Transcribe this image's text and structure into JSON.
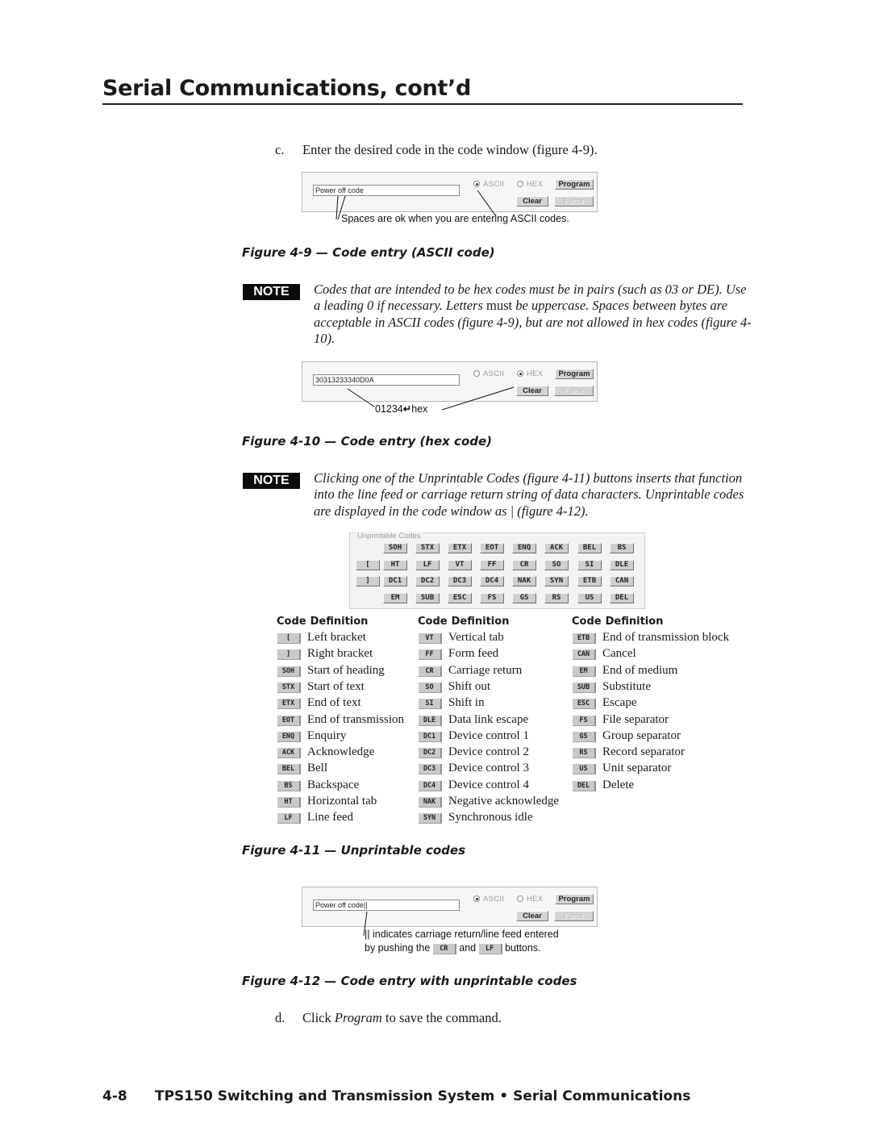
{
  "header": {
    "title": "Serial Communications, cont’d"
  },
  "steps": {
    "c": {
      "marker": "c.",
      "text": "Enter the desired code in the code window (figure 4-9)."
    },
    "d": {
      "marker": "d.",
      "text_before": "Click ",
      "text_em": "Program",
      "text_after": " to save the command."
    }
  },
  "code_window": {
    "radio_ascii": "ASCII",
    "radio_hex": "HEX",
    "program_label": "Program",
    "clear_label": "Clear",
    "force_label": "Force"
  },
  "figure_4_9": {
    "field_value": "Power off code",
    "selected_mode": "ASCII",
    "callout": "Spaces are ok when you are entering ASCII codes.",
    "caption": "Figure 4-9 — Code entry (ASCII code)"
  },
  "note_1": {
    "badge": "NOTE",
    "text_a": "Codes that are intended to be hex codes must be in pairs (such as 03 or DE). Use a leading 0 if necessary.  Letters ",
    "text_upright": "must",
    "text_b": " be uppercase.  Spaces between bytes are acceptable in ASCII codes (figure 4-9), but are not allowed in hex codes (figure 4-10)."
  },
  "figure_4_10": {
    "field_value": "30313233340D0A",
    "selected_mode": "HEX",
    "callout_a": "01234",
    "callout_icon": "return-arrow-icon",
    "callout_b": "hex",
    "caption": "Figure 4-10 — Code entry (hex code)"
  },
  "note_2": {
    "badge": "NOTE",
    "text": "Clicking one of the Unprintable Codes (figure 4-11) buttons inserts that function into the line feed or carriage return string of data characters. Unprintable codes are displayed in the code window as | (figure 4-12)."
  },
  "figure_4_11": {
    "panel_title": "Unprintable Codes",
    "grid": [
      [
        "",
        "SOH",
        "STX",
        "ETX",
        "EOT",
        "ENQ",
        "ACK",
        "BEL",
        "BS"
      ],
      [
        "[",
        "HT",
        "LF",
        "VT",
        "FF",
        "CR",
        "SO",
        "SI",
        "DLE"
      ],
      [
        "]",
        "DC1",
        "DC2",
        "DC3",
        "DC4",
        "NAK",
        "SYN",
        "ETB",
        "CAN"
      ],
      [
        "",
        "EM",
        "SUB",
        "ESC",
        "FS",
        "GS",
        "RS",
        "US",
        "DEL"
      ]
    ],
    "legend_headers": {
      "code": "Code",
      "definition": "Definition"
    },
    "legend_columns": [
      [
        {
          "code": "[",
          "definition": "Left bracket"
        },
        {
          "code": "]",
          "definition": "Right bracket"
        },
        {
          "code": "SOH",
          "definition": "Start of heading"
        },
        {
          "code": "STX",
          "definition": "Start of text"
        },
        {
          "code": "ETX",
          "definition": "End of text"
        },
        {
          "code": "EOT",
          "definition": "End of transmission"
        },
        {
          "code": "ENQ",
          "definition": "Enquiry"
        },
        {
          "code": "ACK",
          "definition": "Acknowledge"
        },
        {
          "code": "BEL",
          "definition": "Bell"
        },
        {
          "code": "BS",
          "definition": "Backspace"
        },
        {
          "code": "HT",
          "definition": "Horizontal tab"
        },
        {
          "code": "LF",
          "definition": "Line feed"
        }
      ],
      [
        {
          "code": "VT",
          "definition": "Vertical tab"
        },
        {
          "code": "FF",
          "definition": "Form feed"
        },
        {
          "code": "CR",
          "definition": "Carriage return"
        },
        {
          "code": "SO",
          "definition": "Shift out"
        },
        {
          "code": "SI",
          "definition": "Shift in"
        },
        {
          "code": "DLE",
          "definition": "Data link escape"
        },
        {
          "code": "DC1",
          "definition": "Device control 1"
        },
        {
          "code": "DC2",
          "definition": "Device control 2"
        },
        {
          "code": "DC3",
          "definition": "Device control 3"
        },
        {
          "code": "DC4",
          "definition": "Device control 4"
        },
        {
          "code": "NAK",
          "definition": "Negative acknowledge"
        },
        {
          "code": "SYN",
          "definition": "Synchronous idle"
        }
      ],
      [
        {
          "code": "ETB",
          "definition": "End of transmission block"
        },
        {
          "code": "CAN",
          "definition": "Cancel"
        },
        {
          "code": "EM",
          "definition": "End of medium"
        },
        {
          "code": "SUB",
          "definition": "Substitute"
        },
        {
          "code": "ESC",
          "definition": "Escape"
        },
        {
          "code": "FS",
          "definition": "File separator"
        },
        {
          "code": "GS",
          "definition": "Group separator"
        },
        {
          "code": "RS",
          "definition": "Record separator"
        },
        {
          "code": "US",
          "definition": "Unit separator"
        },
        {
          "code": "DEL",
          "definition": "Delete"
        }
      ]
    ],
    "caption": "Figure 4-11 — Unprintable codes"
  },
  "figure_4_12": {
    "field_value": "Power off code||",
    "selected_mode": "ASCII",
    "callout_line1": "|| indicates carriage return/line feed entered",
    "callout_line2_a": "by pushing the ",
    "callout_chip_1": "CR",
    "callout_line2_b": " and ",
    "callout_chip_2": "LF",
    "callout_line2_c": " buttons.",
    "caption": "Figure 4-12 — Code entry with unprintable codes"
  },
  "footer": {
    "page_number": "4-8",
    "text": "TPS150 Switching and Transmission System • Serial Communications"
  }
}
